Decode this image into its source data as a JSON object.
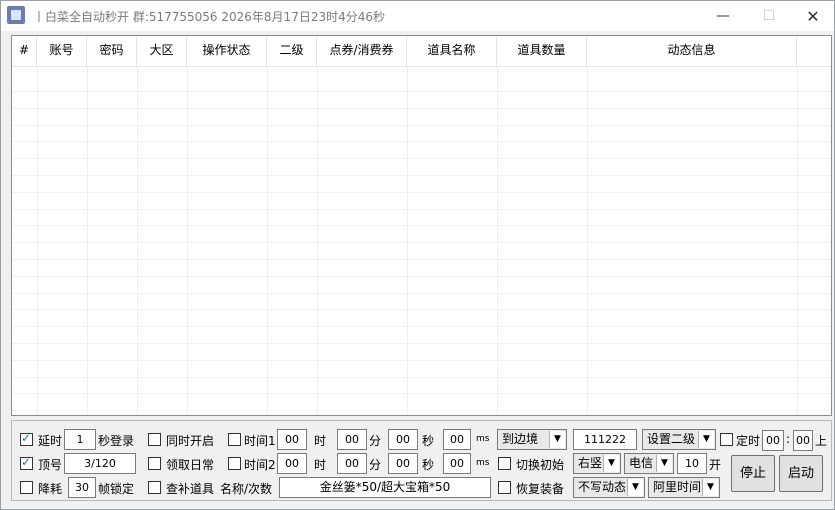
{
  "window": {
    "title": "丨白菜全自动秒开 群:517755056  2026年8月17日23时4分46秒",
    "minimize": "—",
    "maximize": "☐",
    "close": "✕"
  },
  "grid": {
    "columns": [
      "#",
      "账号",
      "密码",
      "大区",
      "操作状态",
      "二级",
      "点券/消费券",
      "道具名称",
      "道具数量",
      "动态信息"
    ]
  },
  "panel": {
    "row1": {
      "delay_label": "延时",
      "delay_value": "1",
      "login_suffix": "秒登录",
      "simul_label": "同时开启",
      "time1_label": "时间1",
      "time1_h": "00",
      "h_unit": "时",
      "time1_m": "00",
      "m_unit": "分",
      "time1_s": "00",
      "s_unit": "秒",
      "time1_ms": "00",
      "ms_unit": "ms",
      "mode_select": "到边境",
      "code_value": "111222",
      "level2_select": "设置二级",
      "timer_label": "定时",
      "timer_h": "00",
      "timer_sep": ":",
      "timer_m": "00",
      "timer_suffix": "上"
    },
    "row2": {
      "top_label": "顶号",
      "top_value": "3/120",
      "daily_label": "领取日常",
      "time2_label": "时间2",
      "time2_h": "00",
      "time2_m": "00",
      "time2_s": "00",
      "time2_ms": "00",
      "switch_label": "切换初始",
      "side_select": "右竖",
      "isp_select": "电信",
      "count_value": "10",
      "count_suffix": "开"
    },
    "row3": {
      "reduce_label": "降耗",
      "fps_value": "30",
      "fps_suffix": "帧锁定",
      "check_items_label": "查补道具",
      "name_count_label": "名称/次数",
      "items_value": "金丝篓*50/超大宝箱*50",
      "restore_label": "恢复装备",
      "dynamic_select": "不写动态",
      "time_source_select": "阿里时间"
    },
    "stop_button": "停止",
    "start_button": "启动",
    "checks": {
      "delay": true,
      "simul": false,
      "time1": false,
      "timer": false,
      "top": true,
      "daily": false,
      "time2": false,
      "switch": false,
      "reduce": false,
      "check_items": false,
      "restore": false
    }
  }
}
